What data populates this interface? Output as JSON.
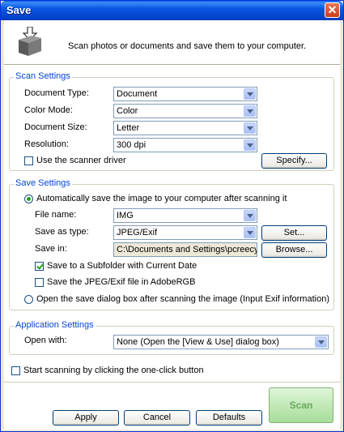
{
  "window": {
    "title": "Save"
  },
  "header": {
    "description": "Scan photos or documents and save them to your computer."
  },
  "scan_settings": {
    "title": "Scan Settings",
    "document_type": {
      "label": "Document Type:",
      "value": "Document"
    },
    "color_mode": {
      "label": "Color Mode:",
      "value": "Color"
    },
    "document_size": {
      "label": "Document Size:",
      "value": "Letter"
    },
    "resolution": {
      "label": "Resolution:",
      "value": "300 dpi"
    },
    "use_driver": {
      "label": "Use the scanner driver",
      "checked": false
    },
    "specify_label": "Specify..."
  },
  "save_settings": {
    "title": "Save Settings",
    "auto_save": {
      "label": "Automatically save the image to your computer after scanning it",
      "selected": true
    },
    "file_name": {
      "label": "File name:",
      "value": "IMG"
    },
    "save_as_type": {
      "label": "Save as  type:",
      "value": "JPEG/Exif"
    },
    "set_label": "Set...",
    "save_in": {
      "label": "Save in:",
      "value": "C:\\Documents and Settings\\pcreecy\\My D"
    },
    "browse_label": "Browse...",
    "subfolder": {
      "label": "Save to a Subfolder with Current Date",
      "checked": true
    },
    "adobergb": {
      "label": "Save the JPEG/Exif file in AdobeRGB",
      "checked": false
    },
    "open_dialog": {
      "label": "Open the save dialog box after scanning the image (Input Exif information)",
      "selected": false
    }
  },
  "application_settings": {
    "title": "Application Settings",
    "open_with": {
      "label": "Open with:",
      "value": "None (Open the [View & Use] dialog box)"
    }
  },
  "one_click": {
    "label": "Start scanning by clicking the one-click button",
    "checked": false
  },
  "buttons": {
    "scan": "Scan",
    "apply": "Apply",
    "cancel": "Cancel",
    "defaults": "Defaults"
  }
}
